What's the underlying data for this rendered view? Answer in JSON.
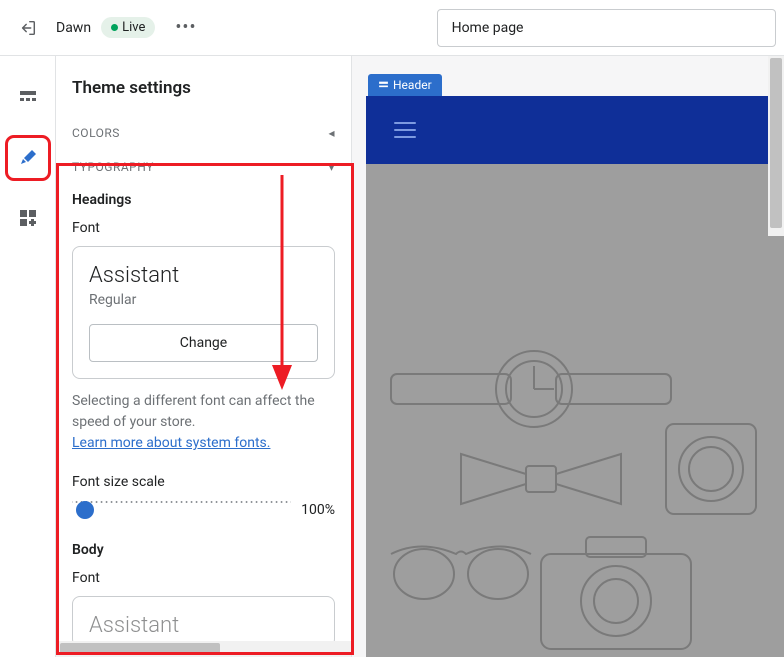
{
  "topbar": {
    "theme_name": "Dawn",
    "status_label": "Live",
    "page_selector": "Home page"
  },
  "sidebar": {
    "title": "Theme settings",
    "sections": {
      "colors": {
        "label": "COLORS"
      },
      "typography": {
        "label": "TYPOGRAPHY",
        "headings": {
          "heading": "Headings",
          "font_label": "Font",
          "font_name": "Assistant",
          "font_style": "Regular",
          "change_button": "Change",
          "helper_text": "Selecting a different font can affect the speed of your store.",
          "learn_link": "Learn more about system fonts."
        },
        "font_scale": {
          "label": "Font size scale",
          "value": "100%"
        },
        "body": {
          "heading": "Body",
          "font_label": "Font",
          "font_name": "Assistant"
        }
      }
    }
  },
  "preview": {
    "header_tag": "Header"
  }
}
